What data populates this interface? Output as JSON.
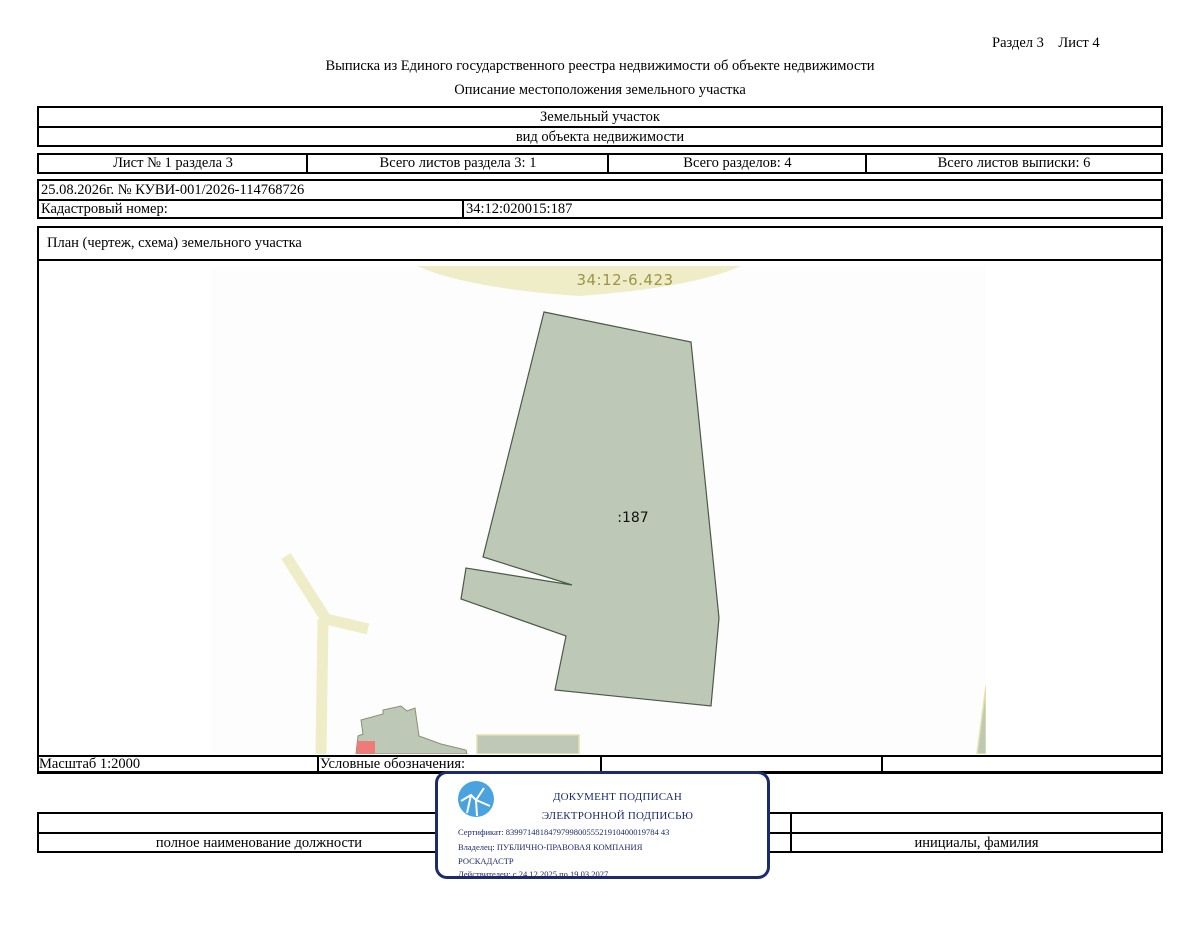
{
  "header": {
    "section_sheet": "Раздел 3    Лист 4",
    "title": "Выписка из Единого государственного реестра недвижимости об объекте недвижимости",
    "subtitle": "Описание местоположения земельного участка"
  },
  "object": {
    "type": "Земельный участок",
    "type_caption": "вид объекта недвижимости"
  },
  "sheets": {
    "sheet_no": "Лист № 1 раздела 3",
    "total_sheets_section": "Всего листов раздела 3: 1",
    "total_sections": "Всего разделов: 4",
    "total_sheets_extract": "Всего листов выписки: 6"
  },
  "record": {
    "date_number": "25.08.2026г. № КУВИ-001/2026-114768726",
    "cadastral_label": "Кадастровый номер:",
    "cadastral_value": "34:12:020015:187"
  },
  "plan": {
    "heading": "План (чертеж, схема) земельного участка",
    "quarter_label": "34:12-6.423",
    "parcel_label": ":187",
    "colors": {
      "parcel_fill": "#bdc9b6",
      "parcel_stroke": "#4a5a45",
      "road": "#efecc8",
      "quarter_text": "#9b9544",
      "building": "#ef7b78"
    }
  },
  "legend": {
    "scale": "Масштаб 1:2000",
    "symbols_label": "Условные обозначения:"
  },
  "signature": {
    "position_caption": "полное наименование должности",
    "name_caption": "инициалы, фамилия"
  },
  "stamp": {
    "line1": "ДОКУМЕНТ ПОДПИСАН",
    "line2": "ЭЛЕКТРОННОЙ ПОДПИСЬЮ",
    "certificate": "Сертификат: 839971481847979980055521910400019784 43",
    "owner_line1": "Владелец: ПУБЛИЧНО-ПРАВОВАЯ КОМПАНИЯ",
    "owner_line2": "РОСКАДАСТР",
    "validity": "Действителен: с 24.12.2025 по 19.03.2027",
    "color": "#1d2a6e",
    "logo_color": "#4aa3df"
  }
}
